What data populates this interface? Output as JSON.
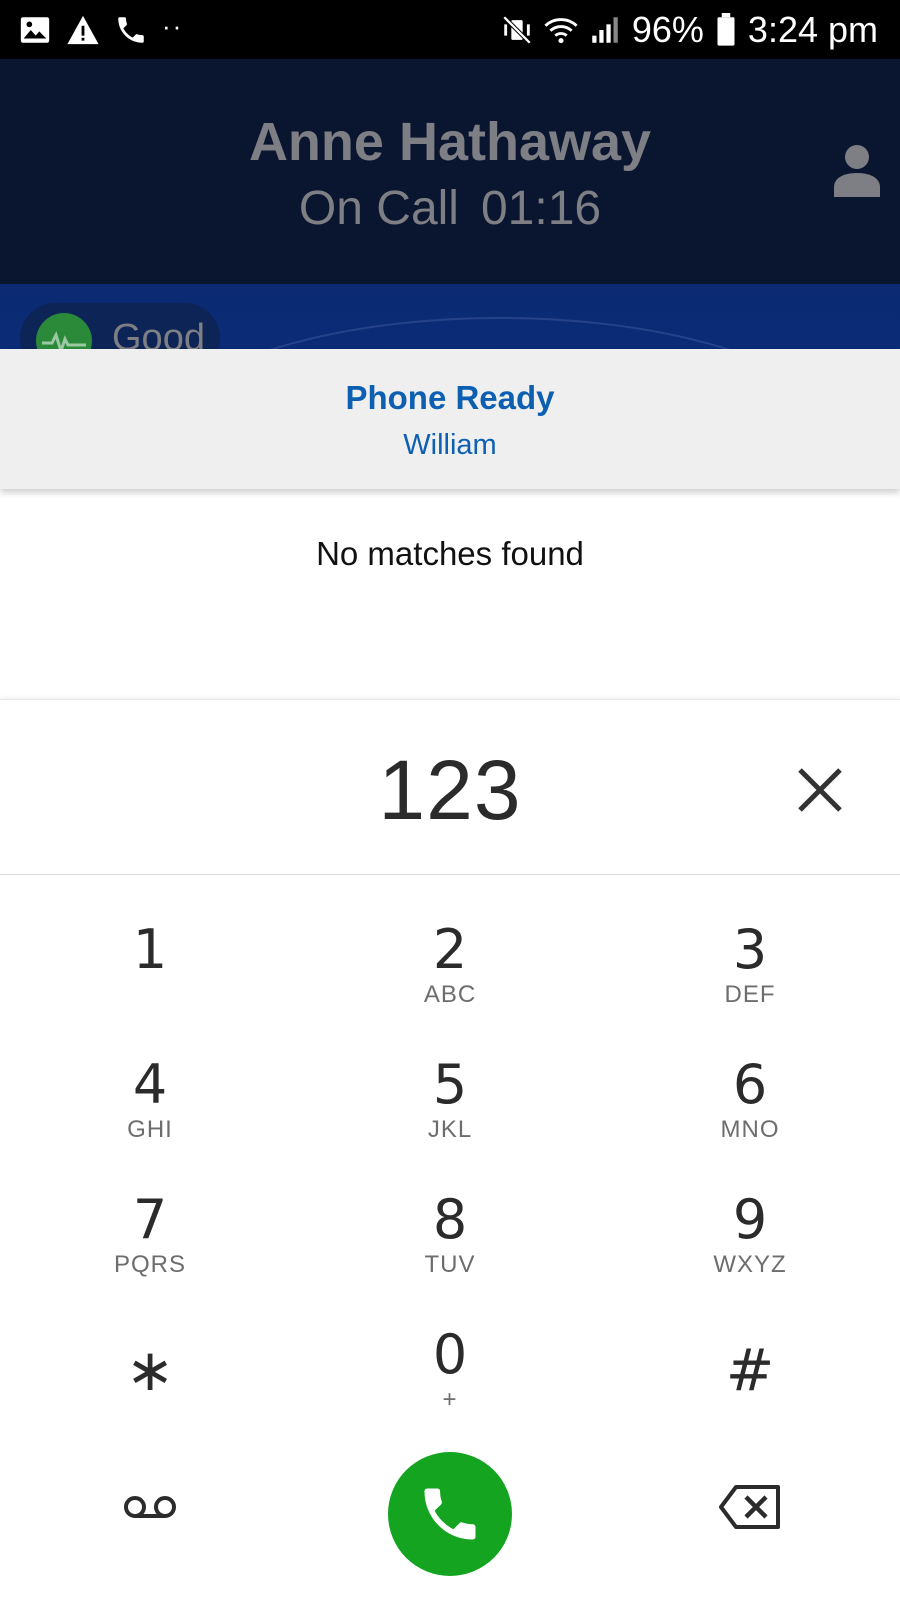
{
  "status_bar": {
    "left_icons": [
      "image-icon",
      "warning-icon",
      "phone-icon"
    ],
    "overflow_dots": "··",
    "right_icons": [
      "vibrate-mute-icon",
      "wifi-icon",
      "signal-icon",
      "battery-icon"
    ],
    "battery_percent": "96%",
    "time": "3:24 pm"
  },
  "call": {
    "caller_name": "Anne Hathaway",
    "status_label": "On Call",
    "duration": "01:16",
    "quality_label": "Good",
    "quality_color": "#2a8a3a",
    "header_bg": "#0a1530"
  },
  "ready_banner": {
    "title": "Phone Ready",
    "user": "William",
    "text_color": "#0d5fb1"
  },
  "search": {
    "empty_message": "No matches found"
  },
  "dialpad": {
    "entered_number": "123",
    "keys": [
      {
        "digit": "1",
        "letters": ""
      },
      {
        "digit": "2",
        "letters": "ABC"
      },
      {
        "digit": "3",
        "letters": "DEF"
      },
      {
        "digit": "4",
        "letters": "GHI"
      },
      {
        "digit": "5",
        "letters": "JKL"
      },
      {
        "digit": "6",
        "letters": "MNO"
      },
      {
        "digit": "7",
        "letters": "PQRS"
      },
      {
        "digit": "8",
        "letters": "TUV"
      },
      {
        "digit": "9",
        "letters": "WXYZ"
      },
      {
        "digit": "∗",
        "letters": ""
      },
      {
        "digit": "0",
        "letters": "+"
      },
      {
        "digit": "#",
        "letters": ""
      }
    ],
    "call_button_color": "#14a41f"
  }
}
